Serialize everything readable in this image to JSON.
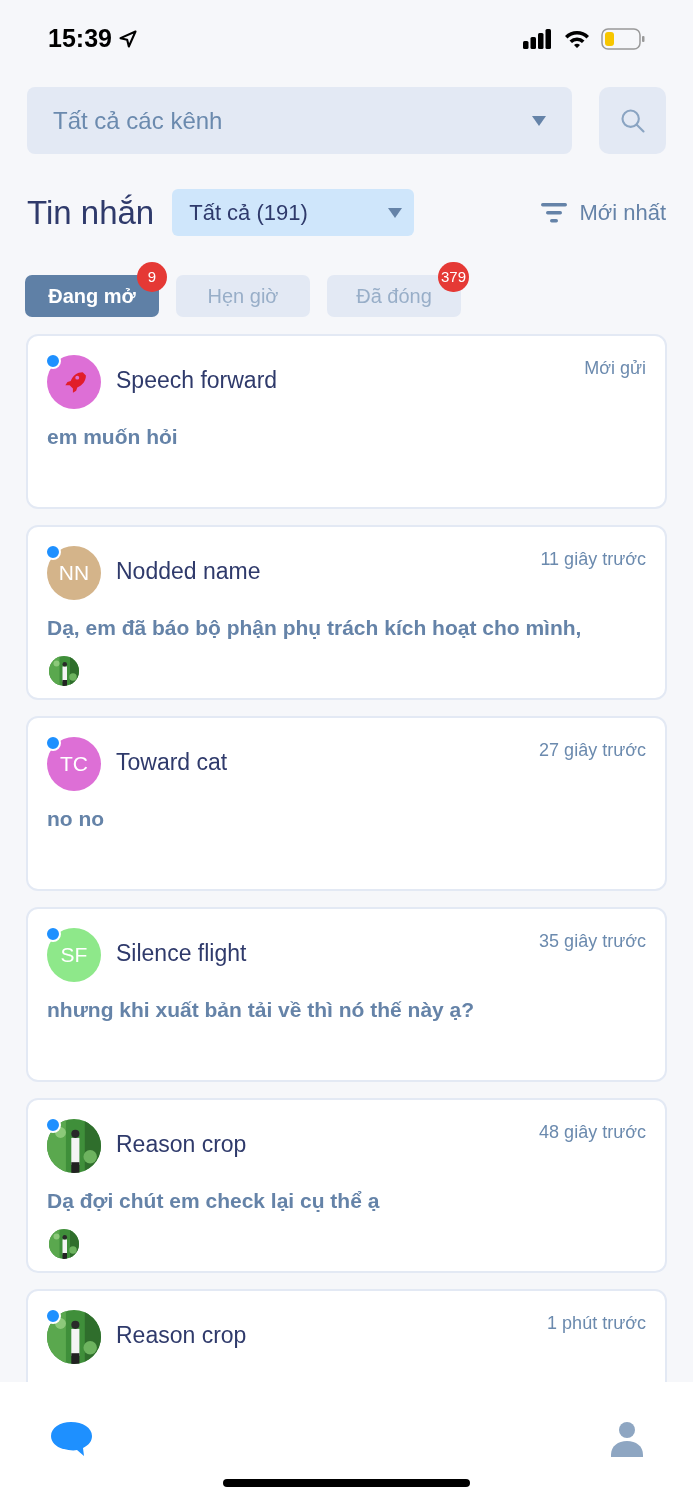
{
  "status_bar": {
    "time": "15:39"
  },
  "channel_select": {
    "value": "Tất cả các kênh"
  },
  "header": {
    "title": "Tin nhắn",
    "filter": "Tất cả (191)",
    "sort": "Mới nhất"
  },
  "tabs": [
    {
      "label": "Đang mở",
      "selected": true,
      "badge": "9"
    },
    {
      "label": "Hẹn giờ",
      "selected": false
    },
    {
      "label": "Đã đóng",
      "selected": false,
      "badge": "379"
    }
  ],
  "conversations": [
    {
      "name": "Speech forward",
      "time": "Mới gửi",
      "message": "em muốn hỏi",
      "online": true,
      "avatar": {
        "kind": "logo"
      }
    },
    {
      "name": "Nodded name",
      "time": "11 giây trước",
      "message": "Dạ, em đã báo bộ phận phụ trách kích hoạt cho mình,",
      "online": true,
      "avatar": {
        "kind": "initials",
        "text": "NN",
        "color": "#d4b48a"
      }
    },
    {
      "name": "Toward cat",
      "time": "27 giây trước",
      "message": "no no",
      "online": true,
      "avatar": {
        "kind": "initials",
        "text": "TC",
        "color": "#dd6fd6"
      }
    },
    {
      "name": "Silence flight",
      "time": "35 giây trước",
      "message": "nhưng khi xuất bản tải về thì nó thế này ạ?",
      "online": true,
      "avatar": {
        "kind": "initials",
        "text": "SF",
        "color": "#8ee88a"
      }
    },
    {
      "name": "Reason crop",
      "time": "48 giây trước",
      "message": "Dạ đợi chút em check lại cụ thể ạ",
      "online": true
    },
    {
      "name": "Reason crop",
      "time": "1 phút trước",
      "online": true
    }
  ],
  "bottom_nav": [
    {
      "kind": "chat",
      "selected": true
    },
    {
      "kind": "profile",
      "selected": false
    }
  ]
}
